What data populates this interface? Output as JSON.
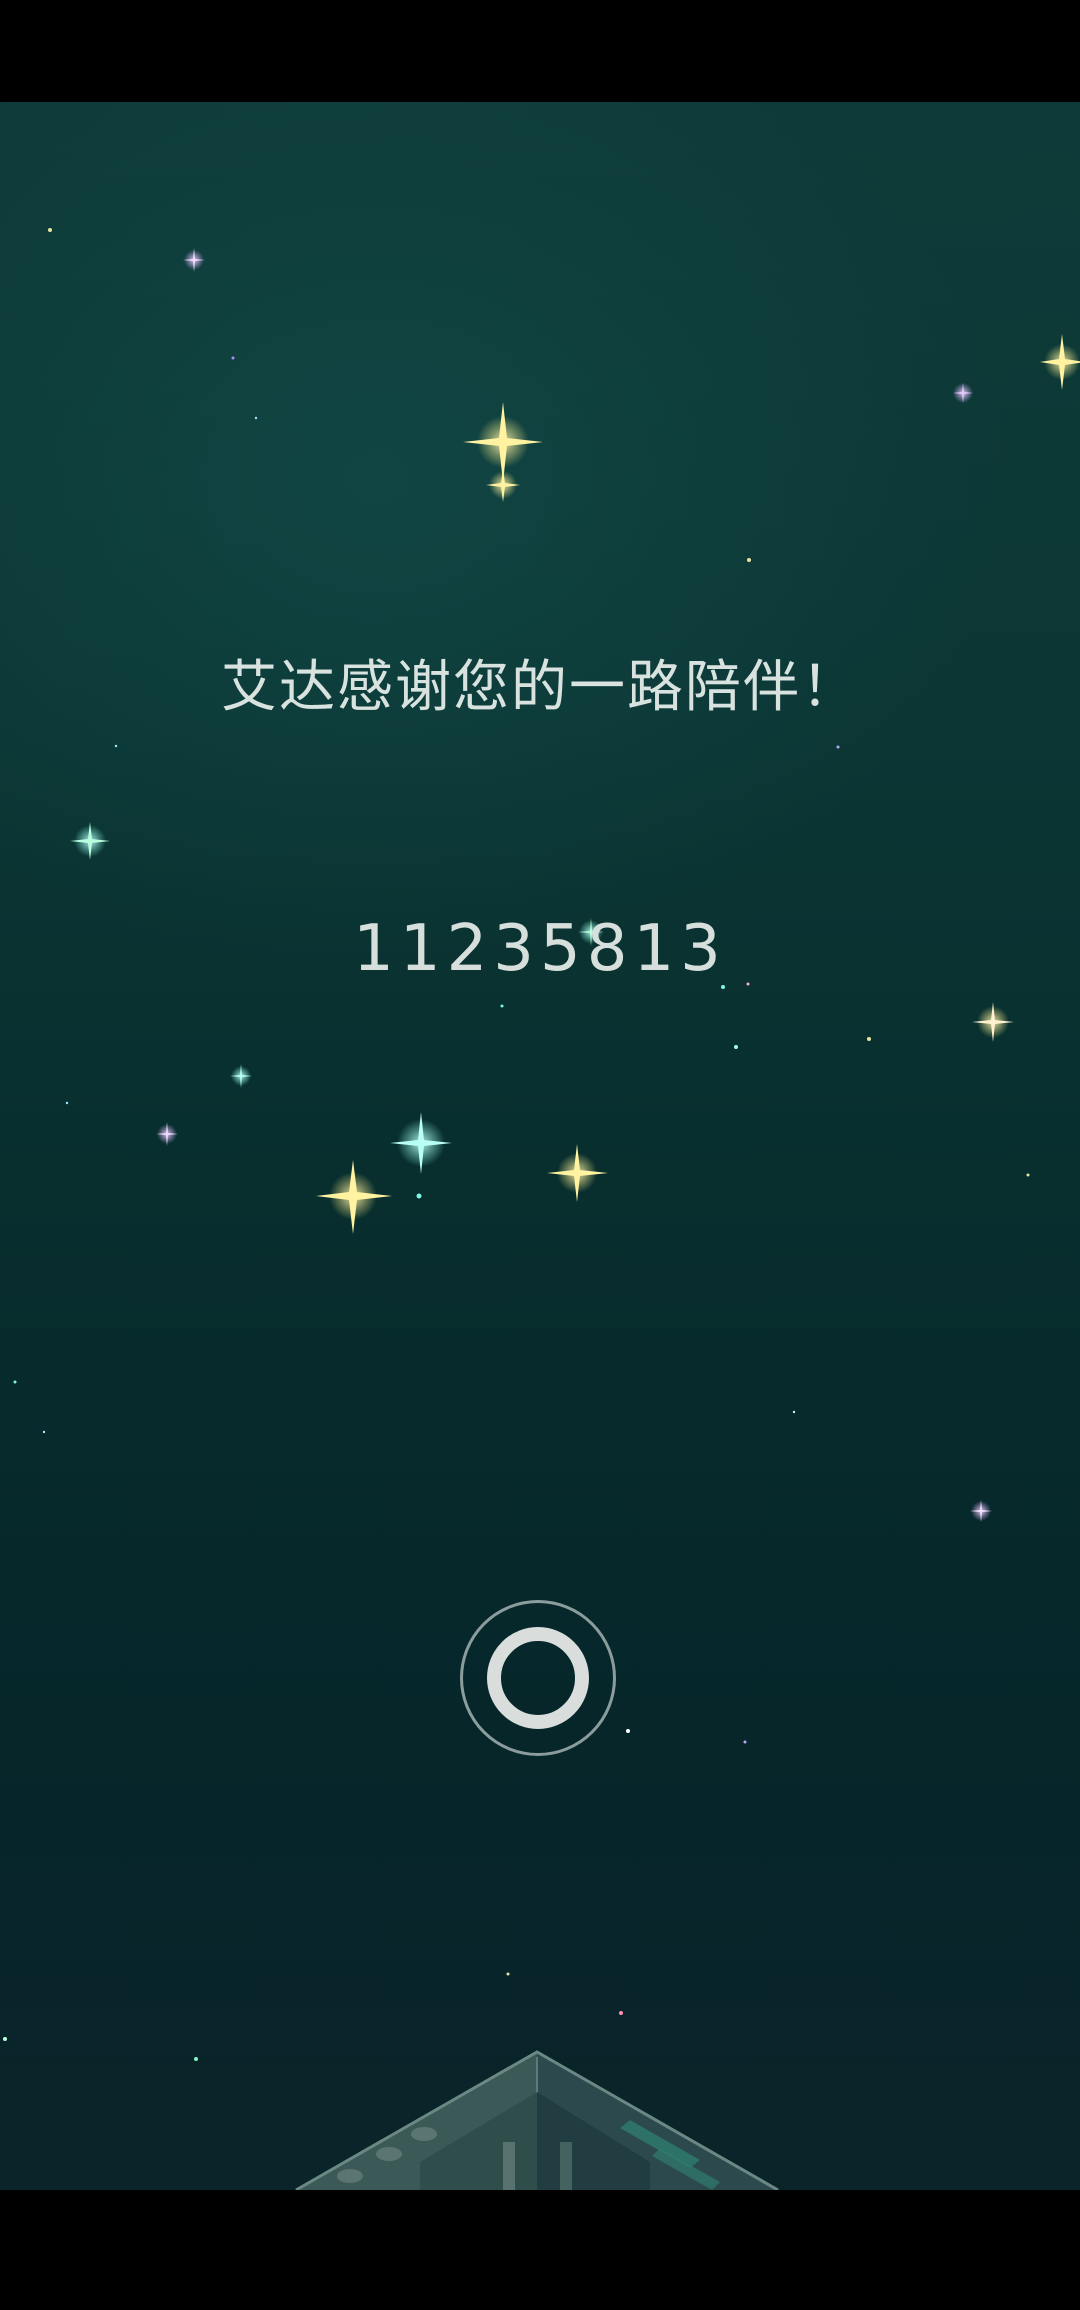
{
  "message": {
    "thanks": "艾达感谢您的一路陪伴！",
    "code": "11235813"
  },
  "controls": {
    "action_icon": "ring-icon"
  },
  "colors": {
    "sky_top": "#0e3b39",
    "sky_bottom": "#06252a",
    "text": "#d8e2df",
    "star_gold": "#f4e27a",
    "star_cyan": "#7ff5e6",
    "star_violet": "#d7a6ff"
  }
}
